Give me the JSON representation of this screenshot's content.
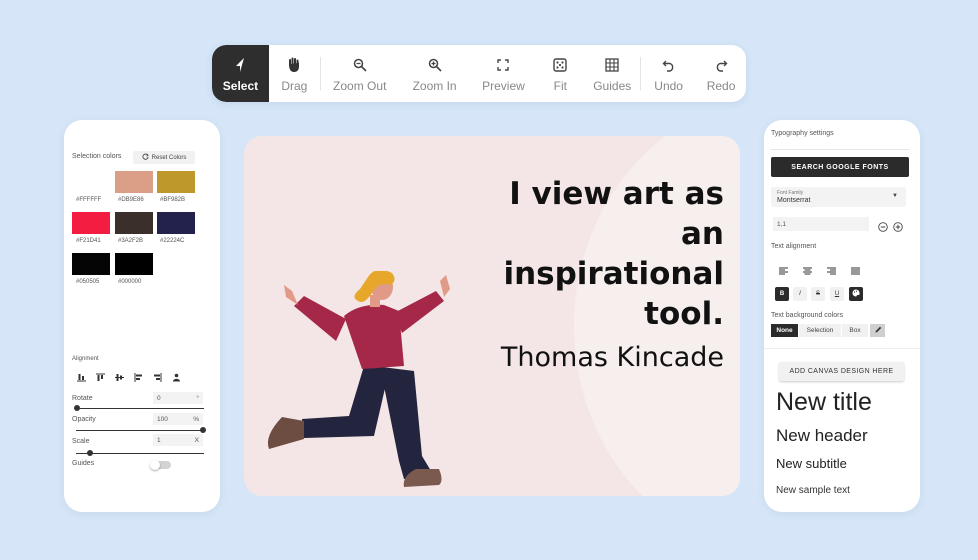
{
  "toolbar": {
    "items": [
      {
        "label": "Select",
        "icon": "cursor-arrow-icon",
        "active": true
      },
      {
        "label": "Drag",
        "icon": "hand-icon"
      },
      {
        "label": "Zoom Out",
        "icon": "zoom-out-icon"
      },
      {
        "label": "Zoom In",
        "icon": "zoom-in-icon"
      },
      {
        "label": "Preview",
        "icon": "fullscreen-icon"
      },
      {
        "label": "Fit",
        "icon": "fit-dice-icon"
      },
      {
        "label": "Guides",
        "icon": "grid-icon"
      },
      {
        "label": "Undo",
        "icon": "undo-icon"
      },
      {
        "label": "Redo",
        "icon": "redo-icon"
      }
    ]
  },
  "left_panel": {
    "selection_colors_label": "Selection colors",
    "reset_colors_label": "Reset Colors",
    "swatches": [
      {
        "color": "#FFFFFF",
        "label": "#FFFFFF"
      },
      {
        "color": "#DB9E86",
        "label": "#DB9E86"
      },
      {
        "color": "#BF982B",
        "label": "#BF982B"
      },
      {
        "color": "#F21D41",
        "label": "#F21D41"
      },
      {
        "color": "#3A2F2B",
        "label": "#3A2F2B"
      },
      {
        "color": "#22224C",
        "label": "#22224C"
      },
      {
        "color": "#050505",
        "label": "#050505"
      },
      {
        "color": "#000000",
        "label": "#000000"
      }
    ],
    "alignment_label": "Alignment",
    "rotate_label": "Rotate",
    "rotate_value": "0",
    "rotate_unit": "°",
    "opacity_label": "Opacity",
    "opacity_value": "100",
    "opacity_unit": "%",
    "scale_label": "Scale",
    "scale_value": "1",
    "scale_unit": "X",
    "guides_label": "Guides"
  },
  "canvas": {
    "quote_lines": [
      "I view art as",
      "an",
      "inspirational",
      "tool."
    ],
    "author": "Thomas Kincade",
    "background_color": "#F4E6E6"
  },
  "right_panel": {
    "title": "Typography settings",
    "search_fonts_label": "SEARCH GOOGLE FONTS",
    "font_family_label": "Font Family",
    "font_family_value": "Montserrat",
    "line_height_value": "1,1",
    "text_alignment_label": "Text alignment",
    "format_buttons": [
      "B",
      "I",
      "S",
      "U"
    ],
    "text_bg_label": "Text background colors",
    "bg_options": [
      "None",
      "Selection",
      "Box"
    ],
    "add_canvas_label": "ADD CANVAS DESIGN HERE",
    "presets": [
      "New title",
      "New header",
      "New subtitle",
      "New sample text"
    ]
  }
}
